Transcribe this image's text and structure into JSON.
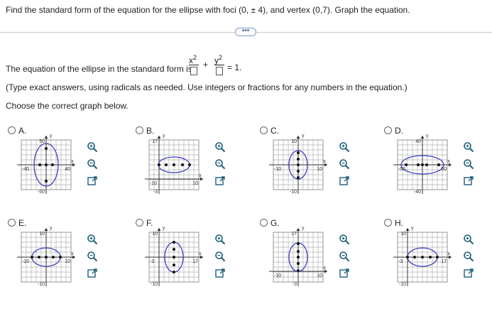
{
  "question": "Find the standard form of the equation for the ellipse with foci (0, ± 4), and vertex (0,7). Graph the equation.",
  "more_button": "•••",
  "equation": {
    "prefix": "The equation of the ellipse in the standard form is",
    "num1": "x",
    "exp1": "2",
    "plus": "+",
    "num2": "y",
    "exp2": "2",
    "suffix": "= 1."
  },
  "note": "(Type exact answers, using radicals as needed. Use integers or fractions for any numbers in the equation.)",
  "choose": "Choose the correct graph below.",
  "options": [
    {
      "label": "A.",
      "ticks": {
        "top": "50",
        "bottom": "-50",
        "left": "-40",
        "right": "40"
      },
      "axis_x": "x",
      "axis_y": "y"
    },
    {
      "label": "B.",
      "ticks": {
        "top": "17",
        "bottom": "-3",
        "left": "-10",
        "right": "10"
      },
      "axis_x": "x",
      "axis_y": "y"
    },
    {
      "label": "C.",
      "ticks": {
        "top": "10",
        "bottom": "-10",
        "left": "-10",
        "right": "10"
      },
      "axis_x": "x",
      "axis_y": "y"
    },
    {
      "label": "D.",
      "ticks": {
        "top": "40",
        "bottom": "-40",
        "left": "-50",
        "right": "50"
      },
      "axis_x": "x",
      "axis_y": "y"
    },
    {
      "label": "E.",
      "ticks": {
        "top": "10",
        "bottom": "-10",
        "left": "-10",
        "right": "10"
      },
      "axis_x": "x",
      "axis_y": "y"
    },
    {
      "label": "F.",
      "ticks": {
        "top": "10",
        "bottom": "-10",
        "left": "-3",
        "right": "17"
      },
      "axis_x": "x",
      "axis_y": "y"
    },
    {
      "label": "G.",
      "ticks": {
        "top": "17",
        "bottom": "-3",
        "left": "-10",
        "right": "10"
      },
      "axis_x": "x",
      "axis_y": "y"
    },
    {
      "label": "H.",
      "ticks": {
        "top": "10",
        "bottom": "-10",
        "left": "-3",
        "right": "17"
      },
      "axis_x": "x",
      "axis_y": "y"
    }
  ],
  "colors": {
    "ellipse": "#3f3fbf",
    "grid": "#b0b0b0",
    "tool": "#1d5f7a",
    "radio": "#666666"
  },
  "icons": [
    "zoom-in-icon",
    "zoom-out-icon",
    "expand-icon"
  ]
}
